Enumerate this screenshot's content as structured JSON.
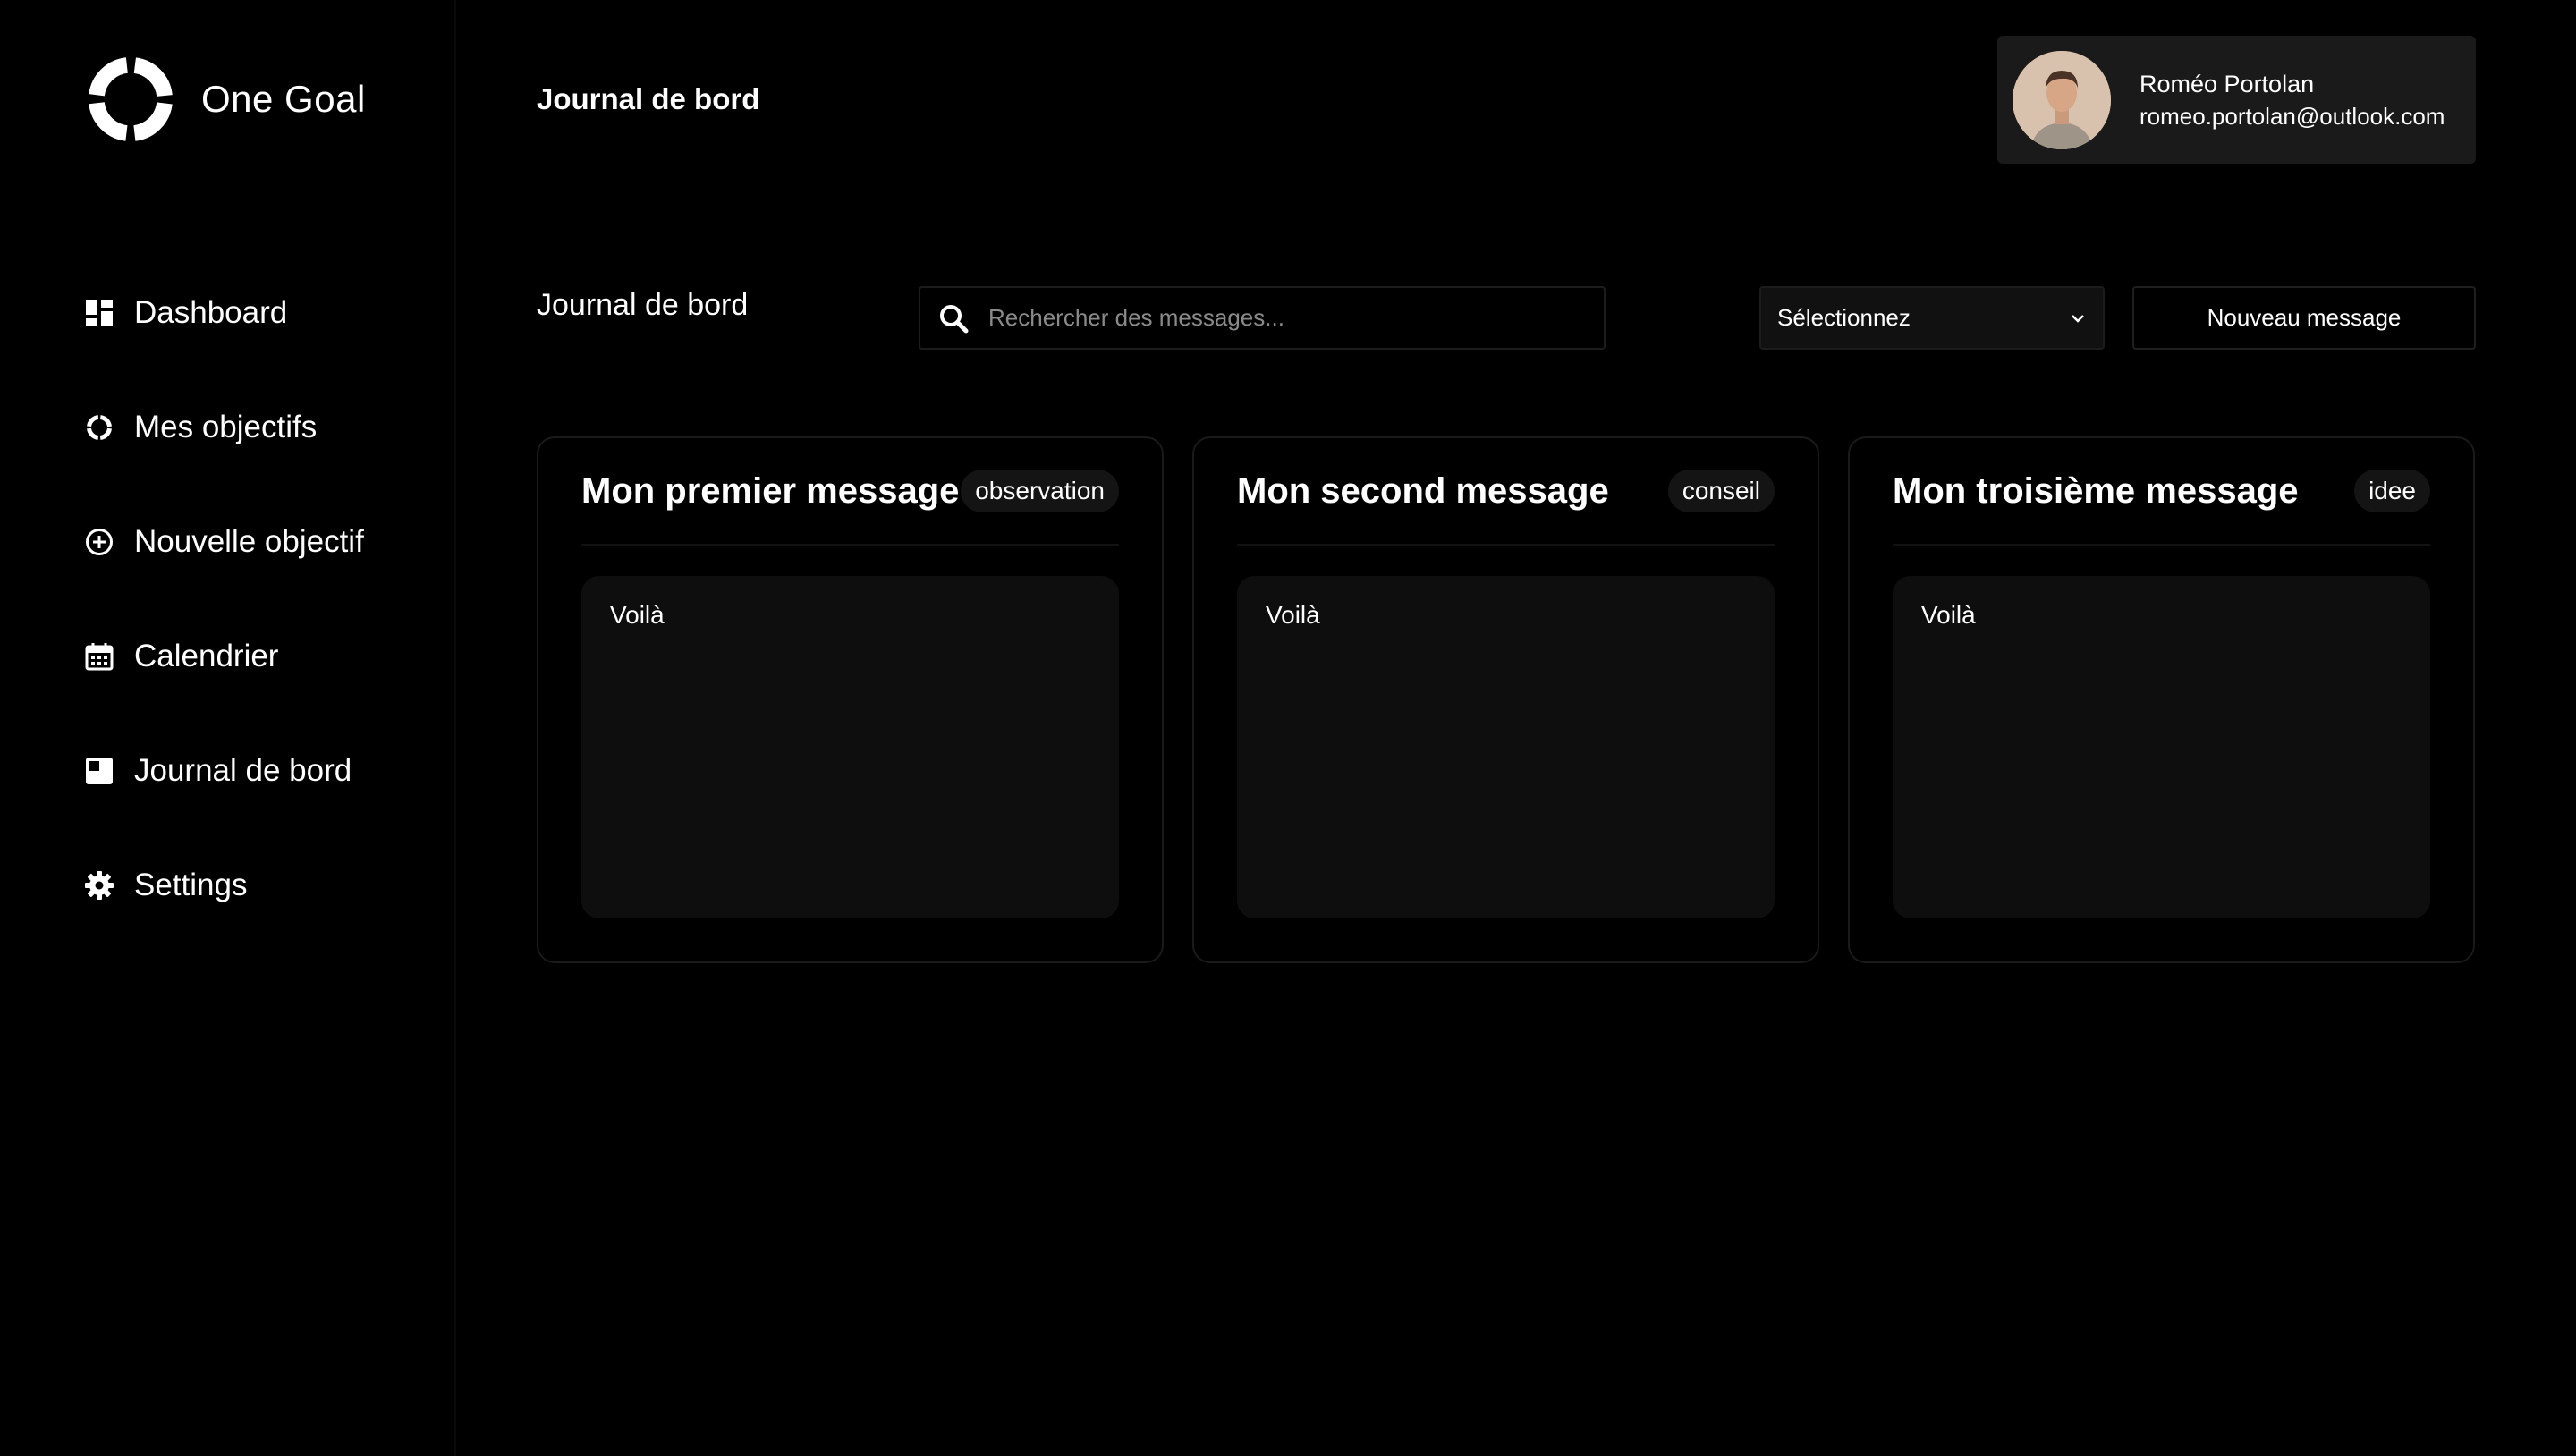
{
  "app": {
    "name": "One Goal"
  },
  "sidebar": {
    "items": [
      {
        "label": "Dashboard",
        "icon": "dashboard-icon"
      },
      {
        "label": "Mes objectifs",
        "icon": "goal-ring-icon"
      },
      {
        "label": "Nouvelle objectif",
        "icon": "plus-circle-icon"
      },
      {
        "label": "Calendrier",
        "icon": "calendar-icon"
      },
      {
        "label": "Journal de bord",
        "icon": "journal-icon"
      },
      {
        "label": "Settings",
        "icon": "gear-icon"
      }
    ]
  },
  "header": {
    "title": "Journal de bord"
  },
  "user": {
    "name": "Roméo Portolan",
    "email": "romeo.portolan@outlook.com"
  },
  "toolbar": {
    "section_title": "Journal de bord",
    "search_placeholder": "Rechercher des messages...",
    "select_value": "Sélectionnez",
    "new_button": "Nouveau message"
  },
  "messages": [
    {
      "title": "Mon premier message",
      "tag": "observation",
      "body": "Voilà"
    },
    {
      "title": "Mon second message",
      "tag": "conseil",
      "body": "Voilà"
    },
    {
      "title": "Mon troisième message",
      "tag": "idee",
      "body": "Voilà"
    }
  ],
  "colors": {
    "background": "#000000",
    "card_body": "#0e0e0e",
    "profile_bg": "#1a1a1a",
    "text": "#ffffff"
  }
}
